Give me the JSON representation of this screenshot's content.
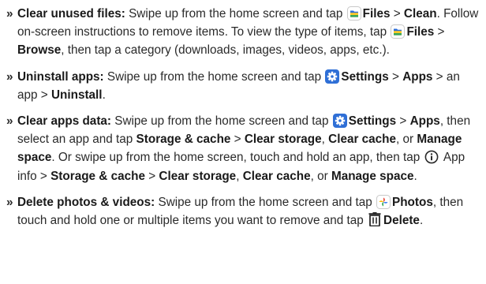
{
  "bullet": "»",
  "items": [
    {
      "title": "Clear unused files:",
      "t1": " Swipe up from the home screen and tap ",
      "files1": "Files",
      "gt1": " > ",
      "clean": "Clean",
      "t2": ". Follow on-screen instructions to remove items. To view the type of items, tap ",
      "files2": "Files",
      "gt2": " > ",
      "browse": "Browse",
      "t3": ", then tap a category (downloads, images, videos, apps, etc.)."
    },
    {
      "title": "Uninstall apps:",
      "t1": " Swipe up from the home screen and tap ",
      "settings": "Settings",
      "gt1": " > ",
      "apps": "Apps",
      "t2": " > an app > ",
      "uninstall": "Uninstall",
      "t3": "."
    },
    {
      "title": "Clear apps data:",
      "t1": " Swipe up from the home screen and tap ",
      "settings": "Settings",
      "gt1": " > ",
      "apps": "Apps",
      "t2": ", then select an app and tap ",
      "storage1": "Storage & cache",
      "gt2": " > ",
      "clearstorage1": "Clear storage",
      "c1": ", ",
      "clearcache1": "Clear cache",
      "or1": ", or ",
      "manage1": "Manage space",
      "t3": ". Or swipe up from the home screen, touch and hold an app, then tap ",
      "appinfo": " App info > ",
      "storage2": "Storage & cache",
      "gt3": " >",
      "sp": " ",
      "clearstorage2": "Clear storage",
      "c2": ", ",
      "clearcache2": "Clear cache",
      "or2": ", or ",
      "manage2": "Manage space",
      "t4": "."
    },
    {
      "title": "Delete photos & videos:",
      "t1": " Swipe up from the home screen and tap ",
      "photos": "Photos",
      "t2": ", then touch and hold one or multiple items you want to remove and tap ",
      "delete": "Delete",
      "t3": "."
    }
  ],
  "icons": {
    "files": "files-app-icon",
    "settings": "settings-gear-icon",
    "info": "info-circle-icon",
    "photos": "photos-pinwheel-icon",
    "trash": "trash-icon"
  },
  "colors": {
    "text": "#2a2a2a",
    "settings_icon": "#2f6fd6",
    "files_icon": "#2f6fd6"
  }
}
